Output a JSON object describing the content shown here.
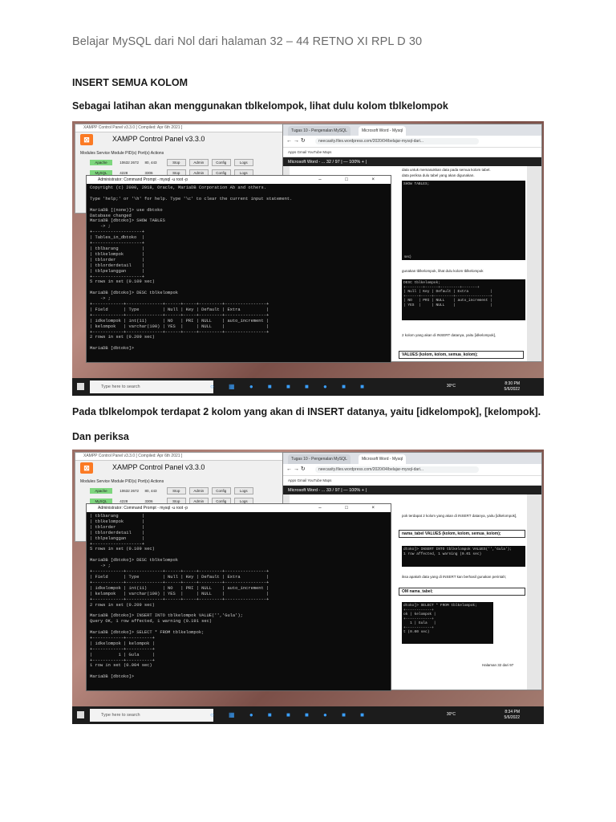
{
  "header": {
    "text": "Belajar MySQL dari Nol dari halaman 32 – 44 RETNO XI RPL D 30"
  },
  "section_title": "INSERT SEMUA KOLOM",
  "para1": "Sebagai latihan akan menggunakan tblkelompok, lihat dulu kolom tblkelompok",
  "para2": "Pada tblkelompok terdapat 2 kolom yang akan di INSERT datanya, yaitu [idkelompok], [kelompok].",
  "para3": "Dan periksa",
  "xampp": {
    "titlebar": "XAMPP Control Panel v3.3.0  [ Compiled: Apr 6th 2021 ]",
    "title": "XAMPP Control Panel v3.3.0",
    "col_headers": "Modules  Service   Module    PID(s)    Port(s)    Actions",
    "rows": [
      {
        "module": "Apache",
        "pid": "10632 2672",
        "port": "80, 443"
      },
      {
        "module": "MySQL",
        "pid": "4228",
        "port": "3306"
      }
    ],
    "buttons": {
      "stop": "Stop",
      "admin": "Admin",
      "config": "Config",
      "logs": "Logs"
    }
  },
  "chrome": {
    "tab1": "Tugas 10 - Pengenalan MySQL",
    "tab2": "Microsoft Word - Mysql",
    "url": "neecasity.files.wordpress.com/2020/04/belajar-mysql-dari...",
    "bookmarks": "Apps   Gmail   YouTube   Maps",
    "wordbar1": "Microsoft Word - ...   32 / 97   |   —  100%  +  |",
    "wordbar2": "Microsoft Word - ...   33 / 97   |   —  100%  +  |",
    "s1_text1": "data untuk memasukkan data pada semua kolom tabel.",
    "s1_text2": "data periksa dulu tabel yang akan digunakan.",
    "s1_mini1": "SHOW TABLES;",
    "s1_mini1b": "sec)",
    "s1_text3": "gunakan tblkelompok, lihat dulu kolom tblkelompok",
    "s1_mini2": "DESC tblkelompok;\n+--------+------+---------+-------+\n| Null | Key | Default | Extra          |\n+------+-----+---------+----------------+\n| NO   | PRI | NULL    | auto_increment |\n| YES  |     | NULL    |                |",
    "s1_text4": "2 kolom yang akan di INSERT datanya, yaitu [idkelompok],",
    "s1_box": "VALUES (kolom, kolom, semua_kolom);",
    "s2_text1": "pok terdapat 2 kolom yang akan di INSERT datanya, yaitu [idkelompok],",
    "s2_box1": "nama_tabel VALUES (kolom, kolom, semua_kolom);",
    "s2_mini1": "dtoko]> INSERT INTO tblkelompok VALUES('','Gula');\n1 row affected, 1 warning (0.01 sec)",
    "s2_text2": "iksa apakah data yang di INSERT kan berhasil gunakan perintah;",
    "s2_box2": "OM  nama_tabel;",
    "s2_mini2": "dtoko]> SELECT * FROM tblkelompok;\n+------------+\nok | kelompok |\n+------------+\n   1 | Gula   |\n+------------+\nt (0.00 sec)",
    "s2_footer": "Halaman 32 dari 97"
  },
  "terminal": {
    "title": "Administrator: Command Prompt - mysql -u root -p",
    "controls": "– □ ×",
    "lines1": "Copyright (c) 2000, 2018, Oracle, MariaDB Corporation Ab and others.\n\nType 'help;' or '\\h' for help. Type '\\c' to clear the current input statement.\n\nMariaDB [(none)]> use dbtoko\nDatabase changed\nMariaDB [dbtoko]> SHOW TABLES\n    -> ;\n+-------------------+\n| Tables_in_dbtoko  |\n+-------------------+\n| tblbarang         |\n| tblkelompok       |\n| tblorder          |\n| tblorderdetail    |\n| tblpelanggan      |\n+-------------------+\n5 rows in set (0.109 sec)\n\nMariaDB [dbtoko]> DESC tblkelompok\n    -> ;\n+------------+--------------+------+-----+---------+----------------+\n| Field      | Type         | Null | Key | Default | Extra          |\n+------------+--------------+------+-----+---------+----------------+\n| idkelompok | int(11)      | NO   | PRI | NULL    | auto_increment |\n| kelompok   | varchar(100) | YES  |     | NULL    |                |\n+------------+--------------+------+-----+---------+----------------+\n2 rows in set (0.209 sec)\n\nMariaDB [dbtoko]>",
    "lines2": "| tblbarang         |\n| tblkelompok       |\n| tblorder          |\n| tblorderdetail    |\n| tblpelanggan      |\n+-------------------+\n5 rows in set (0.109 sec)\n\nMariaDB [dbtoko]> DESC tblkelompok\n    -> ;\n+------------+--------------+------+-----+---------+----------------+\n| Field      | Type         | Null | Key | Default | Extra          |\n+------------+--------------+------+-----+---------+----------------+\n| idkelompok | int(11)      | NO   | PRI | NULL    | auto_increment |\n| kelompok   | varchar(100) | YES  |     | NULL    |                |\n+------------+--------------+------+-----+---------+----------------+\n2 rows in set (0.209 sec)\n\nMariaDB [dbtoko]> INSERT INTO tblkelompok VALUE('','Gula');\nQuery OK, 1 row affected, 1 warning (0.191 sec)\n\nMariaDB [dbtoko]> SELECT * FROM tblkelompok;\n+------------+----------+\n| idkelompok | kelompok |\n+------------+----------+\n|          1 | Gula     |\n+------------+----------+\n1 row in set (0.004 sec)\n\nMariaDB [dbtoko]>"
  },
  "taskbar": {
    "search": "Type here to search",
    "weather": "30°C",
    "time1": "8:30 PM",
    "date1": "5/6/2022",
    "time2": "8:34 PM",
    "date2": "5/6/2022"
  }
}
